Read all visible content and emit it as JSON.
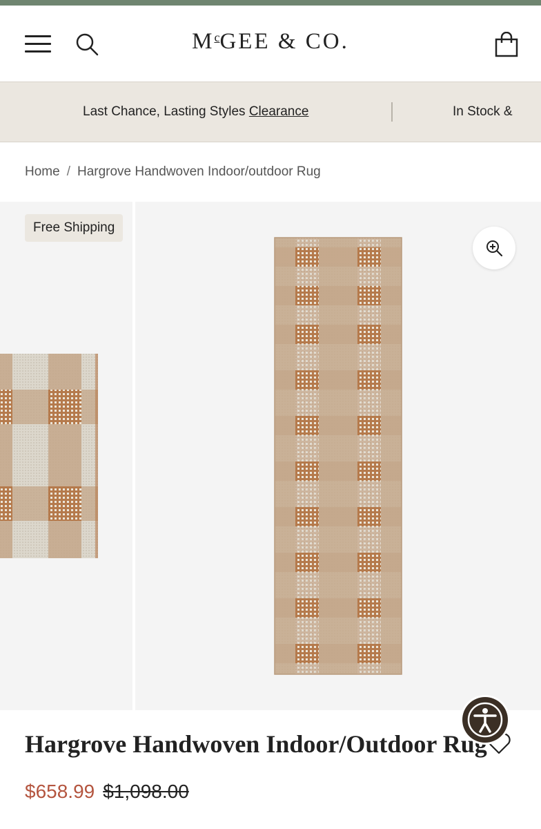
{
  "header": {
    "brand_main": "M",
    "brand_super": "c",
    "brand_rest": "GEE & CO."
  },
  "promo": {
    "lead_text": "Last Chance, Lasting Styles ",
    "link_label": "Clearance",
    "next_text": "In Stock &"
  },
  "breadcrumb": {
    "home": "Home",
    "separator": "/",
    "current": "Hargrove Handwoven Indoor/outdoor Rug"
  },
  "gallery": {
    "badge": "Free Shipping",
    "zoom_icon": "zoom-in-icon"
  },
  "product": {
    "title": "Hargrove Handwoven Indoor/Outdoor Rug",
    "sale_price": "$658.99",
    "original_price": "$1,098.00"
  },
  "colors": {
    "top_strip": "#6f8570",
    "promo_bg": "#ebe7e0",
    "sale_price": "#b4553f",
    "rug_light": "#d9d4c9",
    "rug_tan": "#c4a78a",
    "rug_rust": "#b57a4c",
    "accessibility_bg": "#3b2f25"
  }
}
